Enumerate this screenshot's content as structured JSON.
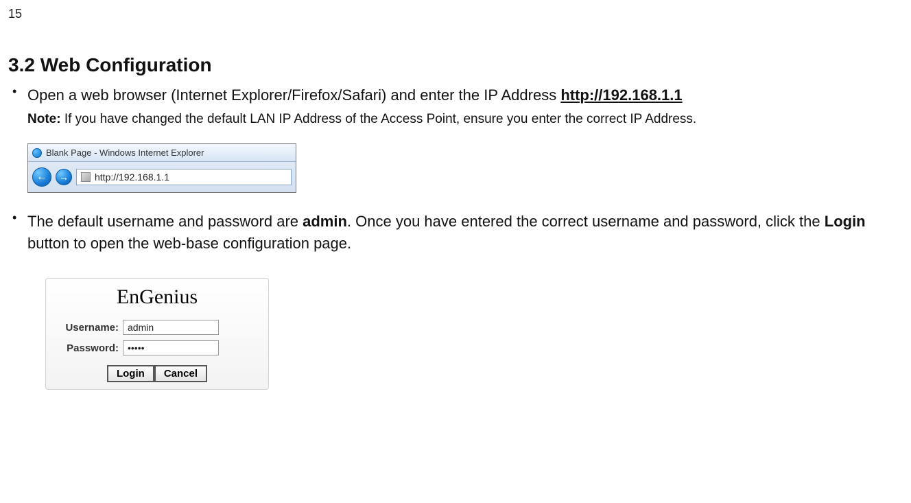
{
  "page_number": "15",
  "heading": "3.2   Web Configuration",
  "bullet1_prefix": "Open a web browser (Internet Explorer/Firefox/Safari) and enter the IP Address ",
  "bullet1_url": "http://192.168.1.1",
  "note_label": "Note:",
  "note_text": " If you have changed the default LAN IP Address of the Access Point, ensure you enter the correct IP Address.",
  "browser": {
    "title": "Blank Page - Windows Internet Explorer",
    "url": "http://192.168.1.1",
    "back_glyph": "←",
    "fwd_glyph": "→"
  },
  "bullet2_a": "The default username and password are ",
  "bullet2_b_bold": "admin",
  "bullet2_c": ". Once you have entered the correct username and password, click the ",
  "bullet2_d_bold": "Login",
  "bullet2_e": " button to open the web-base configuration page.",
  "login": {
    "brand": "EnGenius",
    "username_label": "Username:",
    "username_value": "admin",
    "password_label": "Password:",
    "password_value": "•••••",
    "login_btn": "Login",
    "cancel_btn": "Cancel"
  }
}
